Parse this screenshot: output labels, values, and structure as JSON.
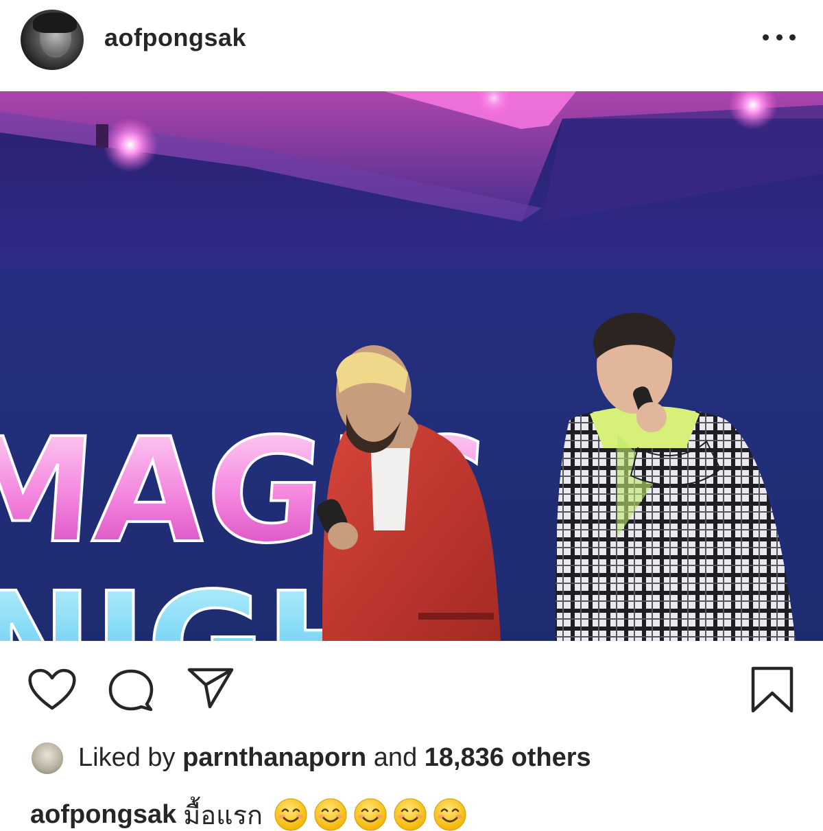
{
  "post": {
    "username": "aofpongsak",
    "avatar_icon": "profile-avatar",
    "more_icon": "more-options-icon"
  },
  "photo": {
    "stage_text_line1": "MAGIC",
    "stage_text_line2": "NIGH"
  },
  "actions": {
    "like_icon": "heart-icon",
    "comment_icon": "comment-icon",
    "share_icon": "send-icon",
    "save_icon": "bookmark-icon"
  },
  "likes": {
    "prefix": "Liked by",
    "liker": "parnthanaporn",
    "conjunction": "and",
    "count_text": "18,836 others"
  },
  "caption": {
    "username": "aofpongsak",
    "text": "มื้อแรก",
    "emoji_count": 5,
    "emoji_name": "smiling-face-with-smiling-eyes"
  },
  "colors": {
    "text": "#262626",
    "background": "#ffffff",
    "stage_pink": "#e85bd0",
    "stage_blue": "#2e2b86"
  }
}
